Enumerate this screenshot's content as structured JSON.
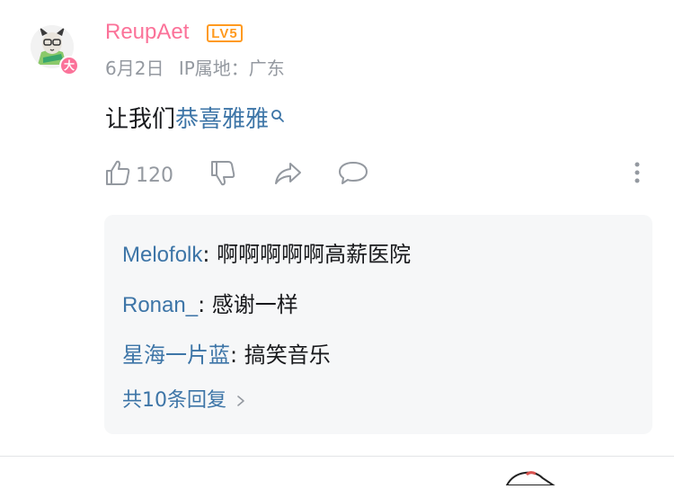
{
  "comment": {
    "username": "ReupAet",
    "level": "LV5",
    "date": "6月2日",
    "ip_location": "IP属地：广东",
    "text_prefix": "让我们",
    "text_link": "恭喜雅雅",
    "likes": "120",
    "avatar_badge": "大"
  },
  "replies": [
    {
      "name": "Melofolk",
      "sep": ":",
      "text": " 啊啊啊啊啊高薪医院"
    },
    {
      "name": "Ronan_",
      "sep": ":",
      "text": " 感谢一样"
    },
    {
      "name": "星海一片蓝",
      "sep": ":",
      "text": " 搞笑音乐"
    }
  ],
  "more_replies": "共10条回复",
  "colors": {
    "username": "#fb7299",
    "level": "#ff9a1f",
    "link": "#3d75a7",
    "muted": "#9499a0",
    "reply_bg": "#f6f7f8"
  },
  "icons": [
    "thumbs-up-icon",
    "thumbs-down-icon",
    "share-icon",
    "reply-bubble-icon",
    "more-vertical-icon",
    "search-icon",
    "chevron-right-icon"
  ]
}
